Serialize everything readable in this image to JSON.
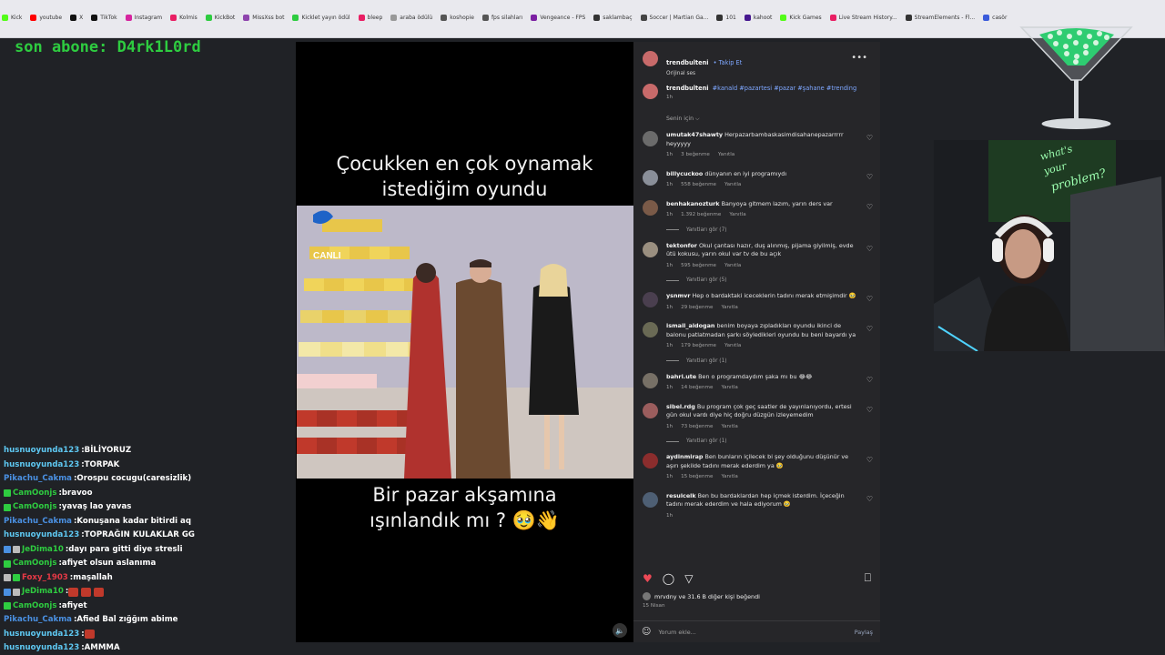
{
  "bookmarks": [
    {
      "label": "Kick",
      "color": "#53fc18"
    },
    {
      "label": "youtube",
      "color": "#ff0000"
    },
    {
      "label": "X",
      "color": "#111111"
    },
    {
      "label": "TikTok",
      "color": "#111111"
    },
    {
      "label": "Instagram",
      "color": "#d6249f"
    },
    {
      "label": "Kolmis",
      "color": "#e91e63"
    },
    {
      "label": "KickBot",
      "color": "#2ecc40"
    },
    {
      "label": "MissXss bot",
      "color": "#8e44ad"
    },
    {
      "label": "Kicklet yayın ödül",
      "color": "#2ecc40"
    },
    {
      "label": "bleep",
      "color": "#e91e63"
    },
    {
      "label": "araba ödülü",
      "color": "#999999"
    },
    {
      "label": "koshopie",
      "color": "#555555"
    },
    {
      "label": "fps silahları",
      "color": "#555555"
    },
    {
      "label": "Vengeance - FPS",
      "color": "#7b1fa2"
    },
    {
      "label": "saklambaç",
      "color": "#333333"
    },
    {
      "label": "Soccer | Martian Ga...",
      "color": "#444444"
    },
    {
      "label": "101",
      "color": "#333333"
    },
    {
      "label": "kahoot",
      "color": "#46178f"
    },
    {
      "label": "Kick Games",
      "color": "#53fc18"
    },
    {
      "label": "Live Stream History...",
      "color": "#e91e63"
    },
    {
      "label": "StreamElements - Fl...",
      "color": "#333333"
    },
    {
      "label": "casör",
      "color": "#3b5bdb"
    }
  ],
  "overlay": {
    "son_abone": "son abone: D4rk1L0rd"
  },
  "chat": [
    {
      "user": "husnuoyunda123",
      "color": "#5ec8f2",
      "msg": "BİLİYORUZ",
      "badges": []
    },
    {
      "user": "husnuoyunda123",
      "color": "#5ec8f2",
      "msg": "TORPAK",
      "badges": []
    },
    {
      "user": "Pikachu_Cakma",
      "color": "#4a90e2",
      "msg": "Orospu cocugu(caresizlik)",
      "badges": []
    },
    {
      "user": "CamOonjs",
      "color": "#2ecc40",
      "msg": "bravoo",
      "badges": [
        "#2ecc40"
      ]
    },
    {
      "user": "CamOonjs",
      "color": "#2ecc40",
      "msg": "yavaş lao yavas",
      "badges": [
        "#2ecc40"
      ]
    },
    {
      "user": "Pikachu_Cakma",
      "color": "#4a90e2",
      "msg": "Konuşana kadar bitirdi aq",
      "badges": []
    },
    {
      "user": "husnuoyunda123",
      "color": "#5ec8f2",
      "msg": "TOPRAĞIN KULAKLAR GG",
      "badges": []
    },
    {
      "user": "JeDima10",
      "color": "#2ecc40",
      "msg": "dayı para gitti diye stresli",
      "badges": [
        "#4a90e2",
        "#bbbbbb"
      ]
    },
    {
      "user": "CamOonjs",
      "color": "#2ecc40",
      "msg": "afiyet olsun aslanıma",
      "badges": [
        "#2ecc40"
      ]
    },
    {
      "user": "Foxy_1903",
      "color": "#e63946",
      "msg": "maşallah",
      "badges": [
        "#bbbbbb",
        "#2ecc40"
      ]
    },
    {
      "user": "JeDima10",
      "color": "#2ecc40",
      "msg": "",
      "badges": [
        "#4a90e2",
        "#bbbbbb"
      ],
      "emotes": 3
    },
    {
      "user": "CamOonjs",
      "color": "#2ecc40",
      "msg": "afiyet",
      "badges": [
        "#2ecc40"
      ]
    },
    {
      "user": "Pikachu_Cakma",
      "color": "#4a90e2",
      "msg": "Afied Bal zığğım abime",
      "badges": []
    },
    {
      "user": "husnuoyunda123",
      "color": "#5ec8f2",
      "msg": "",
      "badges": [],
      "emotes": 1
    },
    {
      "user": "husnuoyunda123",
      "color": "#5ec8f2",
      "msg": "AMMMA",
      "badges": []
    }
  ],
  "video": {
    "top_text_1": "Çocukken en çok oynamak",
    "top_text_2": "istediğim oyundu",
    "bottom_text_1": "Bir pazar akşamına",
    "bottom_text_2": "ışınlandık mı ? 🥹👋",
    "channel_logo": "CANLI"
  },
  "post": {
    "author": "trendbulteni",
    "follow": "• Takip Et",
    "audio": "Orijinal ses",
    "caption_user": "trendbulteni",
    "caption_tags": "#kanald #pazartesi #pazar #şahane #trending",
    "caption_time": "1h",
    "sort_label": "Senin için ⌵",
    "likes_text": "mrvdny ve 31.6 B diğer kişi beğendi",
    "date": "15 Nisan",
    "add_comment_placeholder": "Yorum ekle...",
    "share_label": "Paylaş"
  },
  "comments": [
    {
      "user": "umutak47shawty",
      "text": "Herpazarbambaskasimdisahanepazarrrrr heyyyyy",
      "time": "1h",
      "likes": "3 beğenme",
      "reply": "Yanıtla",
      "color": "#6b6b6b"
    },
    {
      "user": "billycuckoo",
      "text": "dünyanın en iyi programıydı",
      "time": "1h",
      "likes": "558 beğenme",
      "reply": "Yanıtla",
      "color": "#8a8f99"
    },
    {
      "user": "benhakanozturk",
      "text": "Banyoya gitmem lazım, yarın ders var",
      "time": "1h",
      "likes": "1.392 beğenme",
      "reply": "Yanıtla",
      "color": "#7a5a48",
      "replies": "Yanıtları gör (7)"
    },
    {
      "user": "tektonfor",
      "text": "Okul çantası hazır, duş alınmış, pijama giyilmiş, evde ütü kokusu, yarın okul var tv de bu açık",
      "time": "1h",
      "likes": "595 beğenme",
      "reply": "Yanıtla",
      "color": "#9a8f80",
      "replies": "Yanıtları gör (5)"
    },
    {
      "user": "ysnmvr",
      "text": "Hep o bardaktaki iceceklerin tadını merak etmişimdir 🥹",
      "time": "1h",
      "likes": "29 beğenme",
      "reply": "Yanıtla",
      "color": "#4a3f4f"
    },
    {
      "user": "ismail_aldogan",
      "text": "benim boyaya zıpladıkları oyundu ikinci de balonu patlatmadan şarkı söyledikleri oyundu bu beni bayardı ya",
      "time": "1h",
      "likes": "179 beğenme",
      "reply": "Yanıtla",
      "color": "#6a6a55",
      "replies": "Yanıtları gör (1)"
    },
    {
      "user": "bahri.ute",
      "text": "Ben o programdaydım şaka mı bu 😂😂",
      "time": "1h",
      "likes": "14 beğenme",
      "reply": "Yanıtla",
      "color": "#777066"
    },
    {
      "user": "sibel.rdg",
      "text": "Bu program çok geç saatler de yayınlanıyordu, ertesi gün okul vardı diye hiç doğru düzgün izleyemedim",
      "time": "1h",
      "likes": "73 beğenme",
      "reply": "Yanıtla",
      "color": "#9b5d5d",
      "replies": "Yanıtları gör (1)"
    },
    {
      "user": "aydinmirap",
      "text": "Ben bunların içilecek bi şey olduğunu düşünür ve aşırı şekilde tadını merak ederdim ya 🥹",
      "time": "1h",
      "likes": "15 beğenme",
      "reply": "Yanıtla",
      "color": "#8b2d2d"
    },
    {
      "user": "resulcelk",
      "text": "Ben bu bardaklardan hep içmek isterdim. İçeceğin tadını merak ederdim ve hala ediyorum 🥹",
      "time": "1h",
      "likes": "",
      "reply": "",
      "color": "#4e5f74"
    }
  ],
  "colors": {
    "accent_green": "#2ecc40",
    "link_blue": "#7ea7ff",
    "heart_red": "#ed4956"
  }
}
